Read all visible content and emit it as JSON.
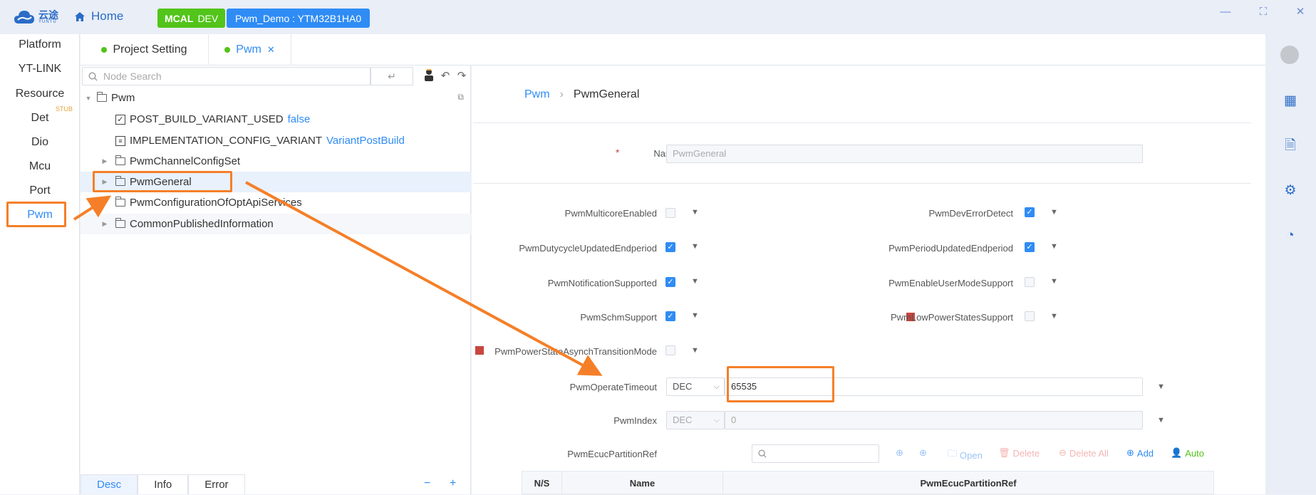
{
  "titlebar": {
    "brand": "云途",
    "brand_sub": "YUNTU",
    "home": "Home",
    "mcal_strong": "MCAL",
    "mcal_dev": "DEV",
    "project": "Pwm_Demo : YTM32B1HA0"
  },
  "leftnav": {
    "items": [
      "Platform",
      "YT-LINK",
      "Resource",
      "Det",
      "Dio",
      "Mcu",
      "Port",
      "Pwm"
    ],
    "stub": "STUB",
    "active": "Pwm"
  },
  "tabs": [
    {
      "label": "Project Setting",
      "dot": true,
      "close": false
    },
    {
      "label": "Pwm",
      "dot": true,
      "close": true
    }
  ],
  "tree": {
    "search_placeholder": "Node Search",
    "rows": [
      {
        "label": "Pwm",
        "value": "",
        "kind": "folder-open",
        "indent": 0
      },
      {
        "label": "POST_BUILD_VARIANT_USED",
        "value": "false",
        "kind": "checkbox",
        "indent": 1
      },
      {
        "label": "IMPLEMENTATION_CONFIG_VARIANT",
        "value": "VariantPostBuild",
        "kind": "enum",
        "indent": 1
      },
      {
        "label": "PwmChannelConfigSet",
        "value": "",
        "kind": "folder",
        "indent": 1
      },
      {
        "label": "PwmGeneral",
        "value": "",
        "kind": "folder",
        "indent": 1,
        "selected": true
      },
      {
        "label": "PwmConfigurationOfOptApiServices",
        "value": "",
        "kind": "folder",
        "indent": 1
      },
      {
        "label": "CommonPublishedInformation",
        "value": "",
        "kind": "folder",
        "indent": 1,
        "hover": true
      }
    ]
  },
  "bottom_tabs": [
    "Desc",
    "Info",
    "Error"
  ],
  "breadcrumb": [
    "Pwm",
    "PwmGeneral"
  ],
  "form": {
    "name_label": "Name",
    "name_value": "PwmGeneral",
    "left_params": [
      {
        "label": "PwmMulticoreEnabled",
        "checked": false,
        "required_flag": false
      },
      {
        "label": "PwmDutycycleUpdatedEndperiod",
        "checked": true,
        "required_flag": false
      },
      {
        "label": "PwmNotificationSupported",
        "checked": true,
        "required_flag": false
      },
      {
        "label": "PwmSchmSupport",
        "checked": true,
        "required_flag": false
      },
      {
        "label": "PwmPowerStateAsynchTransitionMode",
        "checked": false,
        "required_flag": true
      }
    ],
    "right_params": [
      {
        "label": "PwmDevErrorDetect",
        "checked": true,
        "required_flag": false
      },
      {
        "label": "PwmPeriodUpdatedEndperiod",
        "checked": true,
        "required_flag": false
      },
      {
        "label": "PwmEnableUserModeSupport",
        "checked": false,
        "required_flag": false
      },
      {
        "label": "PwmLowPowerStatesSupport",
        "checked": false,
        "required_flag": true
      }
    ],
    "timeout_label": "PwmOperateTimeout",
    "timeout_format": "DEC",
    "timeout_value": "65535",
    "index_label": "PwmIndex",
    "index_format": "DEC",
    "index_value": "0",
    "ecuc_label": "PwmEcucPartitionRef",
    "actions": {
      "open": "Open",
      "delete": "Delete",
      "delete_all": "Delete All",
      "add": "Add",
      "auto": "Auto"
    },
    "table_headers": [
      "N/S",
      "Name",
      "PwmEcucPartitionRef"
    ]
  },
  "colors": {
    "accent": "#2f8cf5",
    "green": "#52c41a",
    "annotation": "#f57f28",
    "required": "#c9453f"
  }
}
